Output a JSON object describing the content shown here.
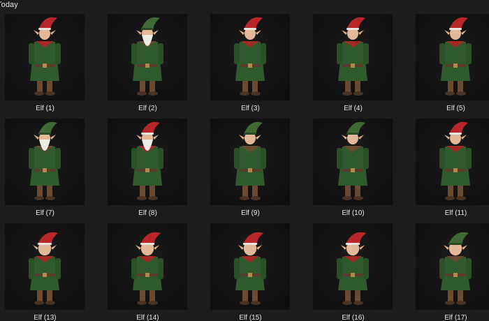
{
  "group": {
    "label": "Today"
  },
  "rows": [
    [
      {
        "label": "Elf (1)",
        "icon": "elf-boy-image",
        "hat": "#b8262a",
        "beard": false
      },
      {
        "label": "Elf (2)",
        "icon": "elf-beard-image",
        "hat": "#3f6a33",
        "beard": true
      },
      {
        "label": "Elf (3)",
        "icon": "elf-image",
        "hat": "#b8262a",
        "beard": false
      },
      {
        "label": "Elf (4)",
        "icon": "elf-image",
        "hat": "#b8262a",
        "beard": false
      },
      {
        "label": "Elf (5)",
        "icon": "elf-image",
        "hat": "#b8262a",
        "beard": false
      }
    ],
    [
      {
        "label": "Elf (7)",
        "icon": "elf-beard-image",
        "hat": "#3f6a33",
        "beard": true
      },
      {
        "label": "Elf (8)",
        "icon": "elf-beard-image",
        "hat": "#b8262a",
        "beard": true
      },
      {
        "label": "Elf (9)",
        "icon": "elf-image",
        "hat": "#3f6a33",
        "beard": false
      },
      {
        "label": "Elf (10)",
        "icon": "elf-image",
        "hat": "#3f6a33",
        "beard": false
      },
      {
        "label": "Elf (11)",
        "icon": "elf-image",
        "hat": "#b8262a",
        "beard": false
      }
    ],
    [
      {
        "label": "Elf (13)",
        "icon": "elf-child-image",
        "hat": "#b8262a",
        "beard": false
      },
      {
        "label": "Elf (14)",
        "icon": "elf-child-image",
        "hat": "#b8262a",
        "beard": false
      },
      {
        "label": "Elf (15)",
        "icon": "elf-child-image",
        "hat": "#b8262a",
        "beard": false
      },
      {
        "label": "Elf (16)",
        "icon": "elf-child-image",
        "hat": "#b8262a",
        "beard": false
      },
      {
        "label": "Elf (17)",
        "icon": "elf-child-image",
        "hat": "#3f6a33",
        "beard": false
      }
    ]
  ]
}
